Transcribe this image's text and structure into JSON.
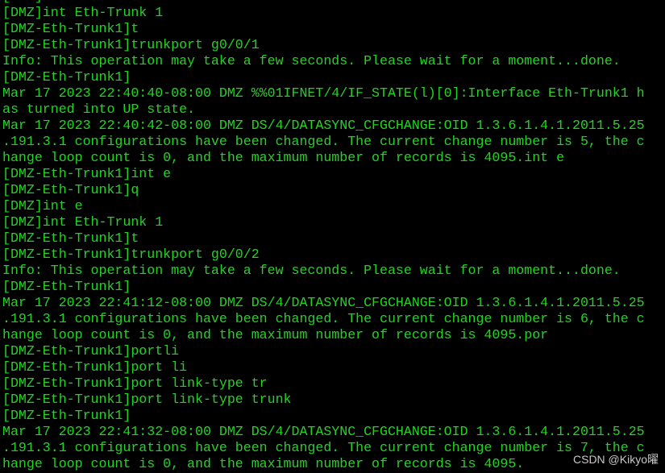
{
  "terminal": {
    "text_color": "#22d422",
    "background": "#000000",
    "lines": [
      "[DMZ]int e",
      "[DMZ]int Eth-Trunk 1",
      "[DMZ-Eth-Trunk1]t",
      "[DMZ-Eth-Trunk1]trunkport g0/0/1",
      "Info: This operation may take a few seconds. Please wait for a moment...done.",
      "[DMZ-Eth-Trunk1]",
      "Mar 17 2023 22:40:40-08:00 DMZ %%01IFNET/4/IF_STATE(l)[0]:Interface Eth-Trunk1 h",
      "as turned into UP state.",
      "Mar 17 2023 22:40:42-08:00 DMZ DS/4/DATASYNC_CFGCHANGE:OID 1.3.6.1.4.1.2011.5.25",
      ".191.3.1 configurations have been changed. The current change number is 5, the c",
      "hange loop count is 0, and the maximum number of records is 4095.int e",
      "[DMZ-Eth-Trunk1]int e",
      "[DMZ-Eth-Trunk1]q",
      "[DMZ]int e",
      "[DMZ]int Eth-Trunk 1",
      "[DMZ-Eth-Trunk1]t",
      "[DMZ-Eth-Trunk1]trunkport g0/0/2",
      "Info: This operation may take a few seconds. Please wait for a moment...done.",
      "[DMZ-Eth-Trunk1]",
      "Mar 17 2023 22:41:12-08:00 DMZ DS/4/DATASYNC_CFGCHANGE:OID 1.3.6.1.4.1.2011.5.25",
      ".191.3.1 configurations have been changed. The current change number is 6, the c",
      "hange loop count is 0, and the maximum number of records is 4095.por",
      "[DMZ-Eth-Trunk1]portli",
      "[DMZ-Eth-Trunk1]port li",
      "[DMZ-Eth-Trunk1]port link-type tr",
      "[DMZ-Eth-Trunk1]port link-type trunk",
      "[DMZ-Eth-Trunk1]",
      "Mar 17 2023 22:41:32-08:00 DMZ DS/4/DATASYNC_CFGCHANGE:OID 1.3.6.1.4.1.2011.5.25",
      ".191.3.1 configurations have been changed. The current change number is 7, the c",
      "hange loop count is 0, and the maximum number of records is 4095."
    ]
  },
  "watermark": "CSDN @Kikyo曜"
}
